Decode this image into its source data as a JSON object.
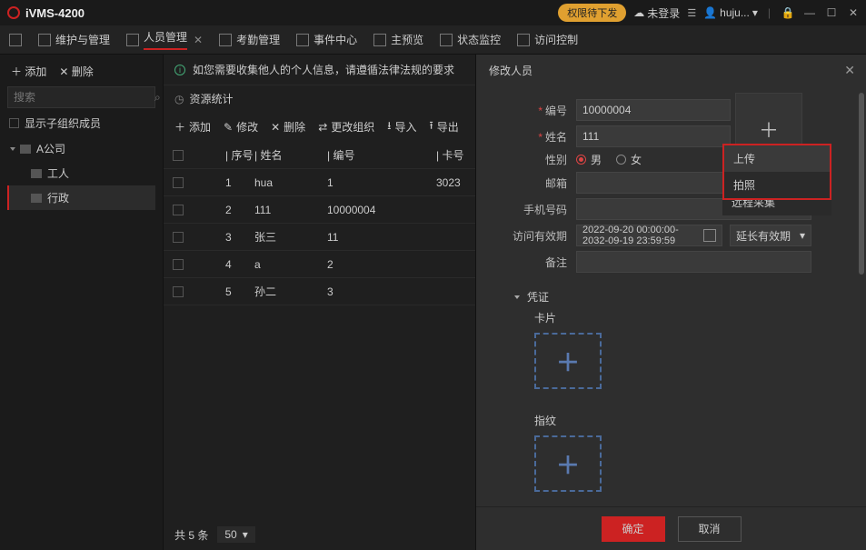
{
  "app": {
    "title": "iVMS-4200"
  },
  "titlebar": {
    "pill": "权限待下发",
    "login": "未登录",
    "user": "huju..."
  },
  "menubar": {
    "items": [
      {
        "label": "维护与管理"
      },
      {
        "label": "人员管理"
      },
      {
        "label": "考勤管理"
      },
      {
        "label": "事件中心"
      },
      {
        "label": "主预览"
      },
      {
        "label": "状态监控"
      },
      {
        "label": "访问控制"
      }
    ]
  },
  "left": {
    "add": "添加",
    "del": "删除",
    "search_ph": "搜索",
    "show_sub": "显示子组织成员",
    "root": "A公司",
    "children": [
      {
        "label": "工人"
      },
      {
        "label": "行政"
      }
    ]
  },
  "center": {
    "banner": "如您需要收集他人的个人信息，请遵循法律法规的要求",
    "stats": "资源统计",
    "toolbar": {
      "add": "添加",
      "edit": "修改",
      "del": "删除",
      "change": "更改组织",
      "import": "导入",
      "export": "导出"
    },
    "cols": {
      "idx": "序号",
      "name": "姓名",
      "code": "编号",
      "card": "卡号"
    },
    "rows": [
      {
        "idx": "1",
        "name": "hua",
        "code": "1",
        "card": "3023"
      },
      {
        "idx": "2",
        "name": "111",
        "code": "10000004",
        "card": ""
      },
      {
        "idx": "3",
        "name": "张三",
        "code": "11",
        "card": ""
      },
      {
        "idx": "4",
        "name": "a",
        "code": "2",
        "card": ""
      },
      {
        "idx": "5",
        "name": "孙二",
        "code": "3",
        "card": ""
      }
    ],
    "footer": {
      "total": "共 5 条",
      "pagesize": "50"
    }
  },
  "panel": {
    "title": "修改人员",
    "fields": {
      "code_l": "编号",
      "code_v": "10000004",
      "name_l": "姓名",
      "name_v": "111",
      "gender_l": "性别",
      "male": "男",
      "female": "女",
      "email_l": "邮箱",
      "email_v": "",
      "phone_l": "手机号码",
      "phone_v": "",
      "valid_l": "访问有效期",
      "valid_v": "2022-09-20 00:00:00-2032-09-19 23:59:59",
      "extend": "延长有效期",
      "remark_l": "备注",
      "remark_v": ""
    },
    "upload_menu": {
      "upload": "上传",
      "capture": "拍照",
      "remote": "远程采集"
    },
    "section": "凭证",
    "card_l": "卡片",
    "finger_l": "指纹",
    "ok": "确定",
    "cancel": "取消"
  }
}
